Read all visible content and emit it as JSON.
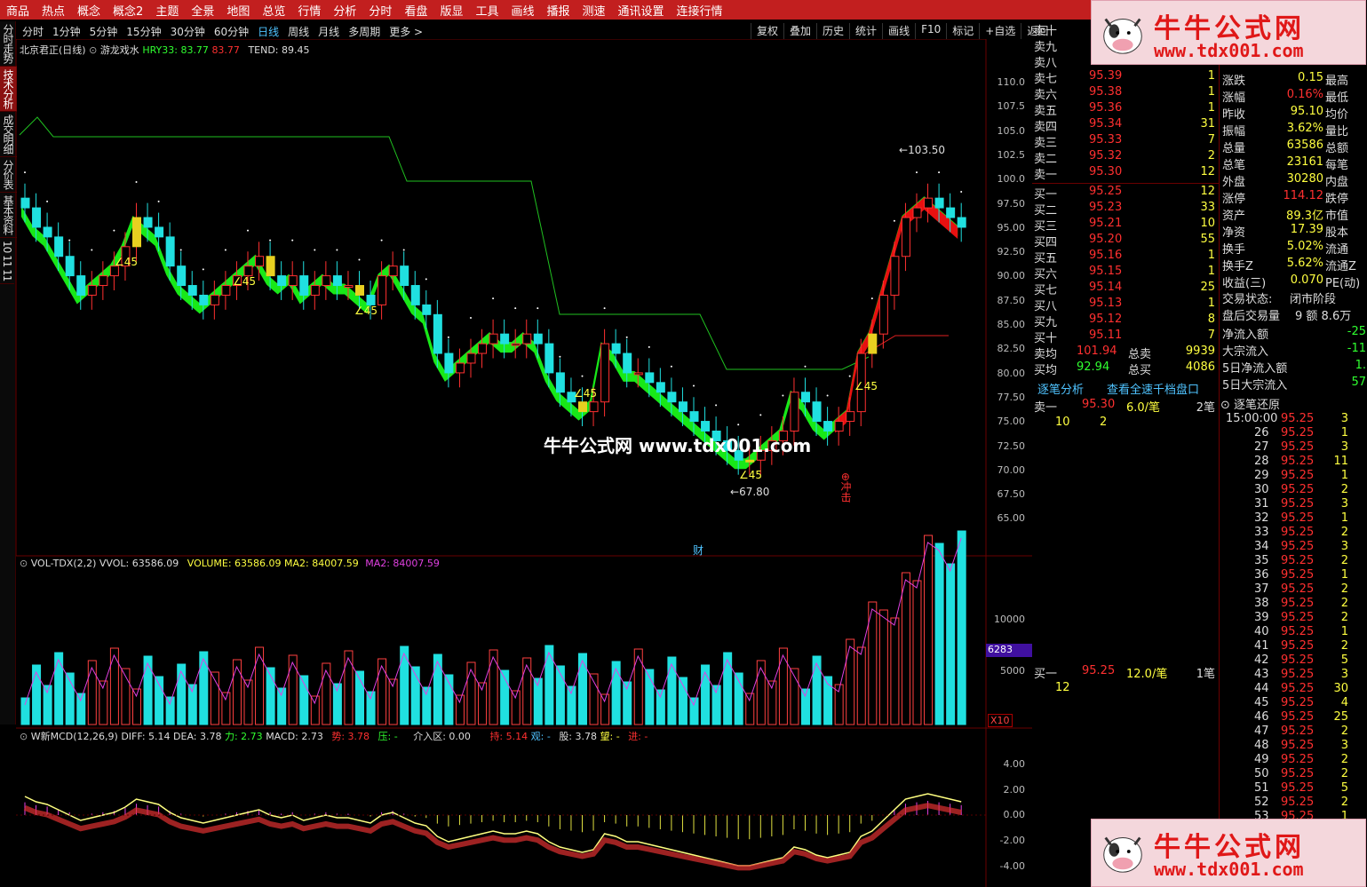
{
  "menu": [
    "商品",
    "热点",
    "概念",
    "概念2",
    "主题",
    "全景",
    "地图",
    "总览",
    "行情",
    "分析",
    "分时",
    "看盘",
    "版显",
    "工具",
    "画线",
    "播报",
    "测速",
    "通讯设置",
    "连接行情"
  ],
  "leftnav": [
    "分时走势",
    "技术分析",
    "成交明细",
    "分价表",
    "基本资料",
    "10 11 11"
  ],
  "periods": [
    "分时",
    "1分钟",
    "5分钟",
    "15分钟",
    "30分钟",
    "60分钟",
    "日线",
    "周线",
    "月线",
    "多周期",
    "更多 >"
  ],
  "period_selected": "日线",
  "tools": [
    "复权",
    "叠加",
    "历史",
    "统计",
    "画线",
    "F10",
    "标记",
    "+自选",
    "返回"
  ],
  "main": {
    "title": "北京君正(日线)",
    "indicator": "游龙戏水",
    "hry_label": "HRY33: 83.77",
    "hry_val": "83.77",
    "tend": "TEND: 89.45",
    "high_mark": "103.50",
    "low_mark": "67.80",
    "angle": "∠45",
    "cai": "财",
    "chongji": "冲击",
    "yticks": [
      "110.0",
      "107.5",
      "105.0",
      "102.5",
      "100.0",
      "97.50",
      "95.00",
      "92.50",
      "90.00",
      "87.50",
      "85.00",
      "82.50",
      "80.00",
      "77.50",
      "75.00",
      "72.50",
      "70.00",
      "67.50",
      "65.00"
    ]
  },
  "vol": {
    "name": "VOL-TDX(2,2)",
    "vvol": "VVOL: 63586.09",
    "volume": "VOLUME: 63586.09",
    "ma2a": "MA2: 84007.59",
    "ma2b": "MA2: 84007.59",
    "yticks": [
      "10000",
      "5000"
    ],
    "tag": "6283",
    "x10": "X10"
  },
  "macd": {
    "name": "W新MCD(12,26,9)",
    "diff": "DIFF: 5.14",
    "dea": "DEA: 3.78",
    "li": "力: 2.73",
    "macd": "MACD: 2.73",
    "shi": "势: 3.78",
    "ya": "压: -",
    "jieru": "介入区: 0.00",
    "chi": "持: 5.14",
    "guan": "观: -",
    "gu": "股: 3.78",
    "wang": "望: -",
    "jin": "进: -",
    "yticks": [
      "4.00",
      "2.00",
      "0.00",
      "-2.00",
      "-4.00"
    ]
  },
  "sell": [
    [
      "卖十",
      "",
      ""
    ],
    [
      "卖九",
      "",
      ""
    ],
    [
      "卖八",
      "",
      ""
    ],
    [
      "卖七",
      "95.39",
      "1"
    ],
    [
      "卖六",
      "95.38",
      "1"
    ],
    [
      "卖五",
      "95.36",
      "1"
    ],
    [
      "卖四",
      "95.34",
      "31"
    ],
    [
      "卖三",
      "95.33",
      "7"
    ],
    [
      "卖二",
      "95.32",
      "2"
    ],
    [
      "卖一",
      "95.30",
      "12"
    ]
  ],
  "buy": [
    [
      "买一",
      "95.25",
      "12"
    ],
    [
      "买二",
      "95.23",
      "33"
    ],
    [
      "买三",
      "95.21",
      "10"
    ],
    [
      "买四",
      "95.20",
      "55"
    ],
    [
      "买五",
      "95.16",
      "1"
    ],
    [
      "买六",
      "95.15",
      "1"
    ],
    [
      "买七",
      "95.14",
      "25"
    ],
    [
      "买八",
      "95.13",
      "1"
    ],
    [
      "买九",
      "95.12",
      "8"
    ],
    [
      "买十",
      "95.11",
      "7"
    ]
  ],
  "avg": [
    [
      "卖均",
      "101.94",
      "总卖",
      "9939"
    ],
    [
      "买均",
      "92.94",
      "总买",
      "4086"
    ]
  ],
  "stats": [
    [
      "涨跌",
      "0.15",
      "最高"
    ],
    [
      "涨幅",
      "0.16%",
      "最低"
    ],
    [
      "昨收",
      "95.10",
      "均价"
    ],
    [
      "振幅",
      "3.62%",
      "量比"
    ],
    [
      "总量",
      "63586",
      "总额"
    ],
    [
      "总笔",
      "23161",
      "每笔"
    ],
    [
      "外盘",
      "30280",
      "内盘"
    ],
    [
      "涨停",
      "114.12",
      "跌停"
    ],
    [
      "资产",
      "89.3亿",
      "市值"
    ],
    [
      "净资",
      "17.39",
      "股本"
    ],
    [
      "换手",
      "5.02%",
      "流通"
    ],
    [
      "换手Z",
      "5.62%",
      "流通Z"
    ],
    [
      "收益(三)",
      "0.070",
      "PE(动)"
    ]
  ],
  "status": {
    "label": "交易状态:",
    "value": "闭市阶段",
    "after": "盘后交易量",
    "after_v": "9 额 8.6万"
  },
  "flows": [
    [
      "净流入额",
      "-25"
    ],
    [
      "大宗流入",
      "-11"
    ],
    [
      "5日净流入额",
      "1."
    ],
    [
      "5日大宗流入",
      "57"
    ]
  ],
  "tabs": {
    "a": "逐笔分析",
    "b": "查看全速千档盘口",
    "c": "逐笔还原"
  },
  "q1": {
    "label": "卖一",
    "price": "95.30",
    "amt": "6.0/笔",
    "cnt": "2笔",
    "a": "10",
    "b": "2"
  },
  "q2": {
    "label": "买一",
    "price": "95.25",
    "amt": "12.0/笔",
    "cnt": "1笔",
    "a": "12"
  },
  "ticks": {
    "first": "15:00:00",
    "rows": [
      [
        "26",
        "95.25",
        "1"
      ],
      [
        "27",
        "95.25",
        "3"
      ],
      [
        "28",
        "95.25",
        "11"
      ],
      [
        "29",
        "95.25",
        "1"
      ],
      [
        "30",
        "95.25",
        "2"
      ],
      [
        "31",
        "95.25",
        "3"
      ],
      [
        "32",
        "95.25",
        "1"
      ],
      [
        "33",
        "95.25",
        "2"
      ],
      [
        "34",
        "95.25",
        "3"
      ],
      [
        "35",
        "95.25",
        "2"
      ],
      [
        "36",
        "95.25",
        "1"
      ],
      [
        "37",
        "95.25",
        "2"
      ],
      [
        "38",
        "95.25",
        "2"
      ],
      [
        "39",
        "95.25",
        "2"
      ],
      [
        "40",
        "95.25",
        "1"
      ],
      [
        "41",
        "95.25",
        "2"
      ],
      [
        "42",
        "95.25",
        "5"
      ],
      [
        "43",
        "95.25",
        "3"
      ],
      [
        "44",
        "95.25",
        "30"
      ],
      [
        "45",
        "95.25",
        "4"
      ],
      [
        "46",
        "95.25",
        "25"
      ],
      [
        "47",
        "95.25",
        "2"
      ],
      [
        "48",
        "95.25",
        "3"
      ],
      [
        "49",
        "95.25",
        "2"
      ],
      [
        "50",
        "95.25",
        "2"
      ],
      [
        "51",
        "95.25",
        "5"
      ],
      [
        "52",
        "95.25",
        "2"
      ],
      [
        "53",
        "95.25",
        "1"
      ]
    ],
    "first_a": "95.25",
    "first_b": "3"
  },
  "watermark": {
    "t1": "牛牛公式网",
    "t2": "www.tdx001.com",
    "center": "牛牛公式网  www.tdx001.com"
  },
  "chart_data": {
    "type": "candlestick",
    "closes": [
      97,
      95,
      94,
      92,
      90,
      88,
      89,
      90,
      91,
      93,
      96,
      95,
      94,
      91,
      89,
      88,
      87,
      88,
      89,
      90,
      91,
      92,
      90,
      89,
      90,
      88,
      89,
      90,
      89,
      89,
      88,
      87,
      90,
      91,
      89,
      87,
      86,
      82,
      80,
      81,
      82,
      83,
      84,
      83,
      83,
      84,
      83,
      80,
      78,
      77,
      76,
      77,
      83,
      82,
      80,
      80,
      79,
      78,
      77,
      76,
      75,
      74,
      73,
      72,
      71,
      71,
      72,
      73,
      74,
      78,
      77,
      75,
      74,
      75,
      76,
      82,
      84,
      88,
      92,
      96,
      97,
      98,
      97,
      96,
      95
    ]
  }
}
